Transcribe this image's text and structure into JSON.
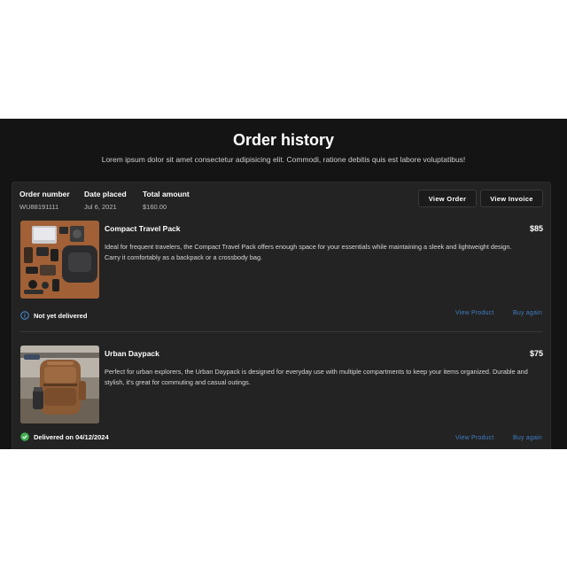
{
  "header": {
    "title": "Order history",
    "subtitle": "Lorem ipsum dolor sit amet consectetur adipisicing elit. Commodi, ratione debitis quis est labore voluptatibus!"
  },
  "order": {
    "number_label": "Order number",
    "number_value": "WU88191111",
    "date_label": "Date placed",
    "date_value": "Jul 6, 2021",
    "total_label": "Total amount",
    "total_value": "$160.00",
    "view_order_label": "View Order",
    "view_invoice_label": "View Invoice"
  },
  "products": [
    {
      "name": "Compact Travel Pack",
      "price": "$85",
      "description": "Ideal for frequent travelers, the Compact Travel Pack offers enough space for your essentials while maintaining a sleek and lightweight design. Carry it comfortably as a backpack or a crossbody bag.",
      "status": "Not yet delivered",
      "status_icon": "info-circle-icon",
      "view_label": "View Product",
      "buy_label": "Buy again"
    },
    {
      "name": "Urban Daypack",
      "price": "$75",
      "description": "Perfect for urban explorers, the Urban Daypack is designed for everyday use with multiple compartments to keep your items organized. Durable and stylish, it's great for commuting and casual outings.",
      "status": "Delivered on 04/12/2024",
      "status_icon": "check-circle-icon",
      "view_label": "View Product",
      "buy_label": "Buy again"
    }
  ],
  "colors": {
    "background": "#141414",
    "card": "#232323",
    "link": "#3f7dc2",
    "info": "#4a90d9",
    "success": "#3fae4f"
  }
}
